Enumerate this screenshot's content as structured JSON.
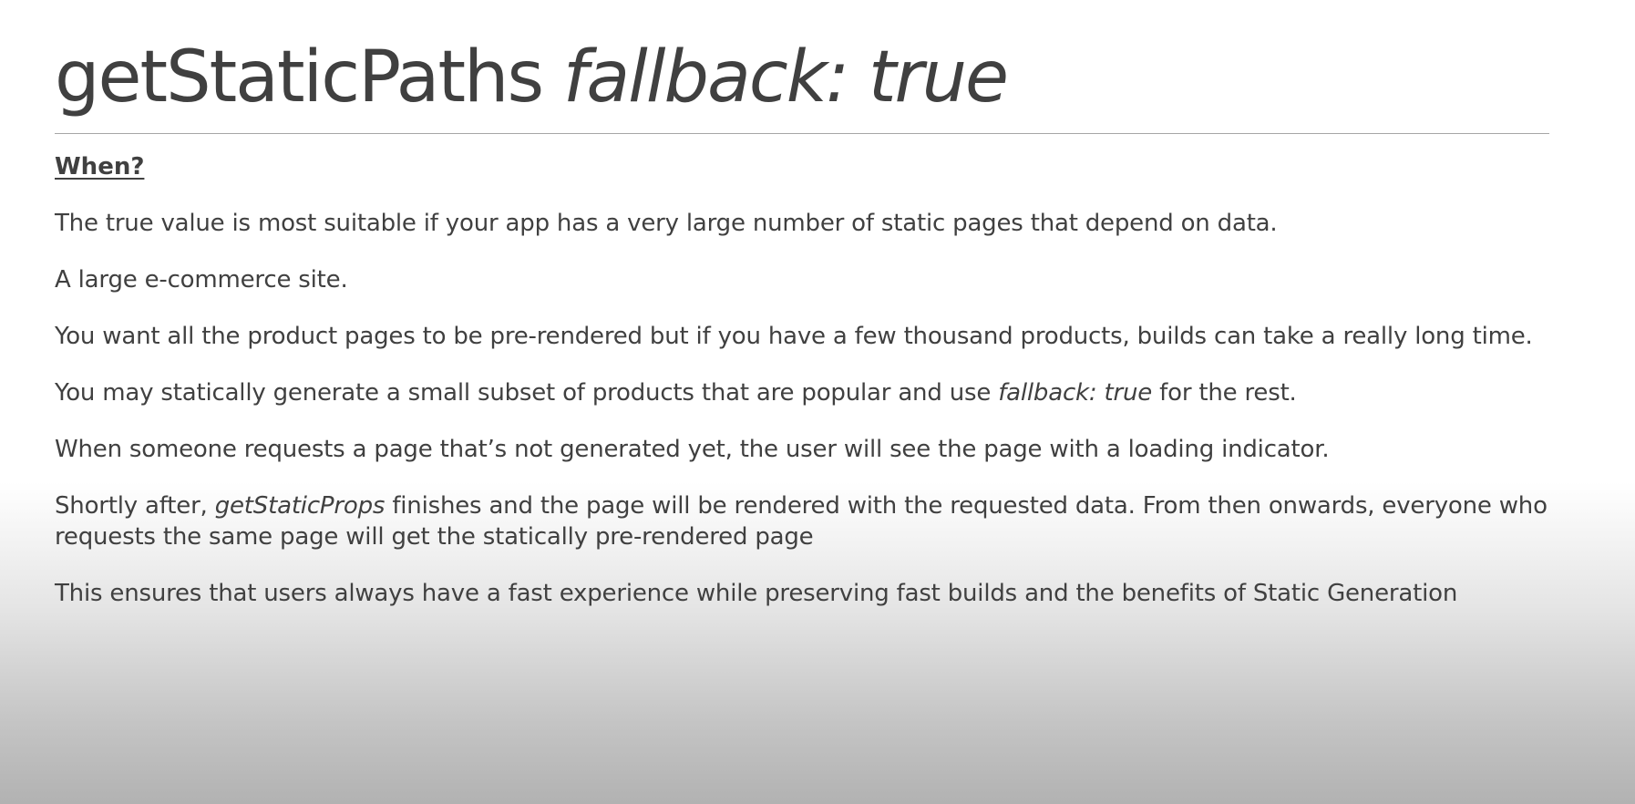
{
  "slide": {
    "title": {
      "main": "getStaticPaths",
      "italic": "fallback: true"
    },
    "heading": "When?",
    "paragraphs": {
      "p1": "The true value is most suitable if your app has a very large number of static pages that depend on data.",
      "p2": "A large e-commerce site.",
      "p3": "You want all the product pages to be pre-rendered but if you have a few thousand products, builds can take a really long time.",
      "p4": {
        "before": "You may statically generate a small subset of products that are popular and use ",
        "italic": "fallback: true",
        "after": " for the rest."
      },
      "p5": "When someone requests a page that’s not generated yet, the user will see the page with a loading indicator.",
      "p6": {
        "before": "Shortly after, ",
        "italic": "getStaticProps",
        "after": " finishes and the page will be rendered with the requested data. From then onwards, everyone who requests the same page will get the statically pre-rendered page"
      },
      "p7": "This ensures that users always have a fast experience while preserving fast builds and the benefits of Static Generation"
    }
  },
  "colors": {
    "text": "#404040",
    "rule": "#a6a6a6",
    "background_top": "#ffffff",
    "background_bottom": "#b2b2b2"
  }
}
